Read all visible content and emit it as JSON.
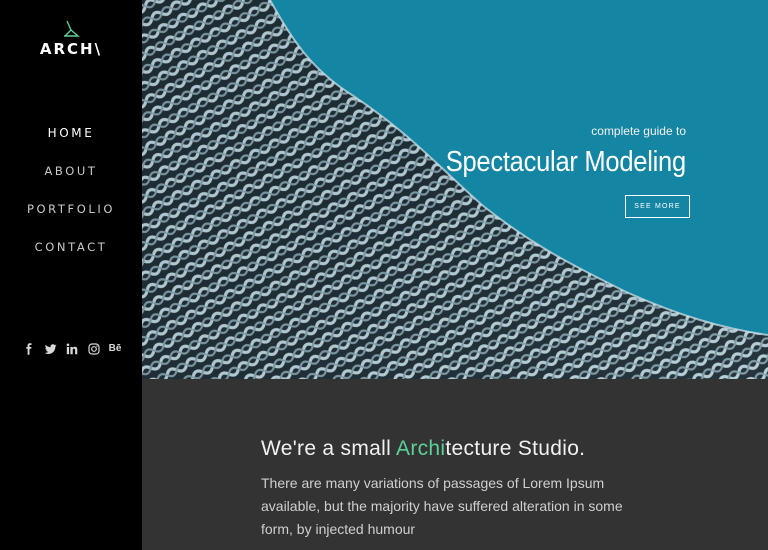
{
  "brand": {
    "logo_text": "ARCH\\"
  },
  "nav": {
    "items": [
      {
        "label": "HOME",
        "active": true
      },
      {
        "label": "ABOUT",
        "active": false
      },
      {
        "label": "PORTFOLIO",
        "active": false
      },
      {
        "label": "CONTACT",
        "active": false
      }
    ]
  },
  "social": [
    {
      "icon": "facebook-icon",
      "glyph": "f"
    },
    {
      "icon": "twitter-icon",
      "glyph": ""
    },
    {
      "icon": "linkedin-icon",
      "glyph": "in"
    },
    {
      "icon": "instagram-icon",
      "glyph": ""
    },
    {
      "icon": "behance-icon",
      "glyph": "Bē"
    }
  ],
  "hero": {
    "kicker": "complete guide to",
    "title": "Spectacular Modeling",
    "button_label": "SEE MORE",
    "sky_color": "#1485a3"
  },
  "about": {
    "heading_prefix": "We're a small ",
    "heading_accent": "Archi",
    "heading_suffix": "tecture Studio.",
    "accent_color": "#5dcf99",
    "body": "There are many variations of passages of Lorem Ipsum available, but the majority have suffered alteration in some form, by injected humour"
  }
}
